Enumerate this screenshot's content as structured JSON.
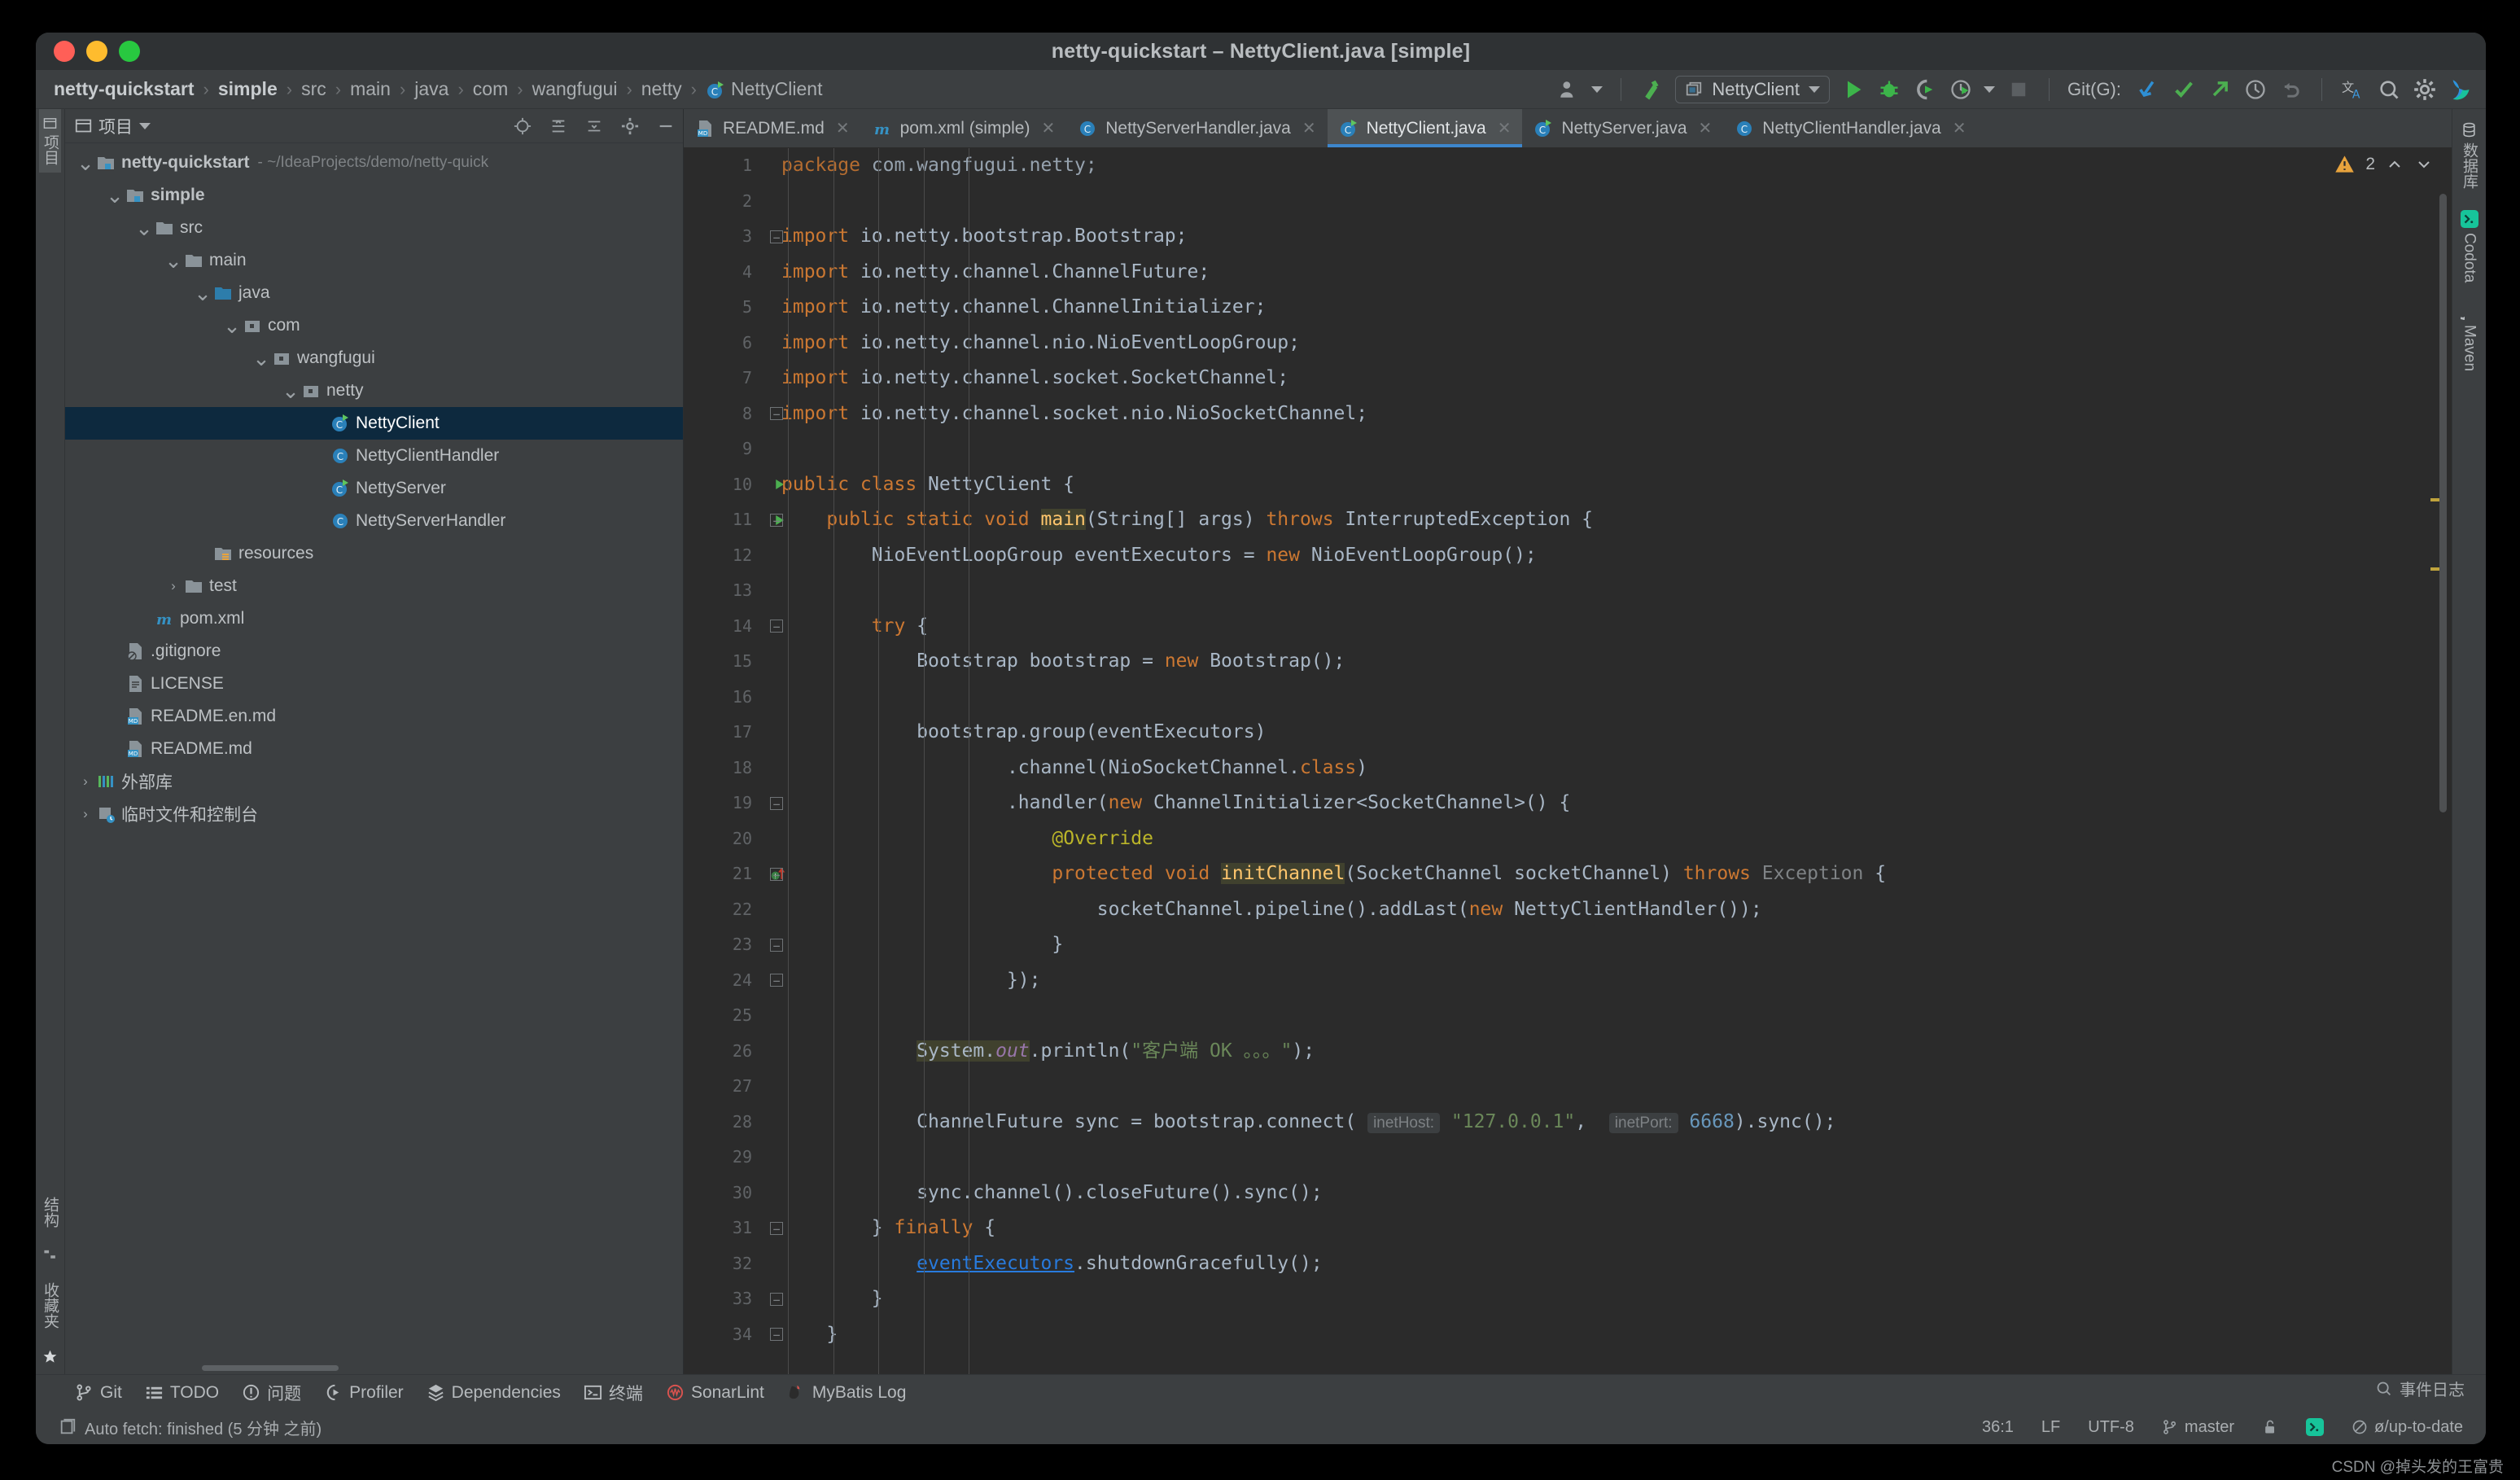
{
  "window": {
    "title": "netty-quickstart – NettyClient.java [simple]",
    "traffic": {
      "close": "close-button",
      "minimize": "minimize-button",
      "zoom": "zoom-button"
    }
  },
  "breadcrumbs": [
    {
      "label": "netty-quickstart",
      "bold": true
    },
    {
      "label": "simple",
      "bold": true
    },
    {
      "label": "src",
      "bold": false
    },
    {
      "label": "main",
      "bold": false
    },
    {
      "label": "java",
      "bold": false
    },
    {
      "label": "com",
      "bold": false
    },
    {
      "label": "wangfugui",
      "bold": false
    },
    {
      "label": "netty",
      "bold": false
    },
    {
      "label": "NettyClient",
      "bold": false,
      "icon": "java-class-runnable-icon"
    }
  ],
  "toolbar": {
    "run_config": "NettyClient",
    "git_label": "Git(G):",
    "buttons": [
      "user-icon",
      "build-hammer-icon",
      "run-icon",
      "debug-icon",
      "run-with-coverage-icon",
      "profile-icon",
      "stop-icon",
      "git-update-icon",
      "git-commit-icon",
      "git-push-icon",
      "history-icon",
      "rollback-icon",
      "translate-icon",
      "search-everywhere-icon",
      "settings-gear-icon",
      "codota-icon"
    ]
  },
  "left_strip": {
    "top": [
      {
        "label": "项目",
        "selected": true,
        "icon": "project-icon"
      }
    ],
    "bottom": [
      {
        "label": "结构",
        "icon": "structure-icon"
      },
      {
        "label": "收藏夹",
        "icon": "favorites-star-icon"
      }
    ]
  },
  "right_strip": [
    {
      "label": "数据库",
      "icon": "database-icon"
    },
    {
      "label": "Codota",
      "icon": "codota-icon"
    },
    {
      "label": "Maven",
      "icon": "maven-icon"
    }
  ],
  "project_panel": {
    "title": "项目",
    "tree": [
      {
        "depth": 0,
        "label": "netty-quickstart",
        "suffix": "- ~/IdeaProjects/demo/netty-quick",
        "arrow": "down",
        "icon": "module-icon",
        "bold": true,
        "selected": false
      },
      {
        "depth": 1,
        "label": "simple",
        "suffix": "",
        "arrow": "down",
        "icon": "module-icon",
        "bold": true,
        "selected": false
      },
      {
        "depth": 2,
        "label": "src",
        "suffix": "",
        "arrow": "down",
        "icon": "folder-icon",
        "bold": false,
        "selected": false
      },
      {
        "depth": 3,
        "label": "main",
        "suffix": "",
        "arrow": "down",
        "icon": "folder-icon",
        "bold": false,
        "selected": false
      },
      {
        "depth": 4,
        "label": "java",
        "suffix": "",
        "arrow": "down",
        "icon": "source-folder-icon",
        "bold": false,
        "selected": false
      },
      {
        "depth": 5,
        "label": "com",
        "suffix": "",
        "arrow": "down",
        "icon": "package-icon",
        "bold": false,
        "selected": false
      },
      {
        "depth": 6,
        "label": "wangfugui",
        "suffix": "",
        "arrow": "down",
        "icon": "package-icon",
        "bold": false,
        "selected": false
      },
      {
        "depth": 7,
        "label": "netty",
        "suffix": "",
        "arrow": "down",
        "icon": "package-icon",
        "bold": false,
        "selected": false
      },
      {
        "depth": 8,
        "label": "NettyClient",
        "suffix": "",
        "arrow": "none",
        "icon": "java-class-runnable-icon",
        "bold": false,
        "selected": true
      },
      {
        "depth": 8,
        "label": "NettyClientHandler",
        "suffix": "",
        "arrow": "none",
        "icon": "java-class-icon",
        "bold": false,
        "selected": false
      },
      {
        "depth": 8,
        "label": "NettyServer",
        "suffix": "",
        "arrow": "none",
        "icon": "java-class-runnable-icon",
        "bold": false,
        "selected": false
      },
      {
        "depth": 8,
        "label": "NettyServerHandler",
        "suffix": "",
        "arrow": "none",
        "icon": "java-class-icon",
        "bold": false,
        "selected": false
      },
      {
        "depth": 4,
        "label": "resources",
        "suffix": "",
        "arrow": "none",
        "icon": "resources-folder-icon",
        "bold": false,
        "selected": false
      },
      {
        "depth": 3,
        "label": "test",
        "suffix": "",
        "arrow": "right",
        "icon": "folder-icon",
        "bold": false,
        "selected": false
      },
      {
        "depth": 2,
        "label": "pom.xml",
        "suffix": "",
        "arrow": "none",
        "icon": "maven-icon",
        "bold": false,
        "selected": false
      },
      {
        "depth": 1,
        "label": ".gitignore",
        "suffix": "",
        "arrow": "none",
        "icon": "gitignore-icon",
        "bold": false,
        "selected": false
      },
      {
        "depth": 1,
        "label": "LICENSE",
        "suffix": "",
        "arrow": "none",
        "icon": "text-file-icon",
        "bold": false,
        "selected": false
      },
      {
        "depth": 1,
        "label": "README.en.md",
        "suffix": "",
        "arrow": "none",
        "icon": "markdown-icon",
        "bold": false,
        "selected": false
      },
      {
        "depth": 1,
        "label": "README.md",
        "suffix": "",
        "arrow": "none",
        "icon": "markdown-icon",
        "bold": false,
        "selected": false
      },
      {
        "depth": 0,
        "label": "外部库",
        "suffix": "",
        "arrow": "right",
        "icon": "external-libraries-icon",
        "bold": false,
        "selected": false
      },
      {
        "depth": 0,
        "label": "临时文件和控制台",
        "suffix": "",
        "arrow": "right",
        "icon": "scratches-icon",
        "bold": false,
        "selected": false
      }
    ]
  },
  "editor_tabs": [
    {
      "label": "README.md",
      "icon": "markdown-icon",
      "active": false
    },
    {
      "label": "pom.xml (simple)",
      "icon": "maven-icon",
      "active": false
    },
    {
      "label": "NettyServerHandler.java",
      "icon": "java-class-icon",
      "active": false
    },
    {
      "label": "NettyClient.java",
      "icon": "java-class-runnable-icon",
      "active": true
    },
    {
      "label": "NettyServer.java",
      "icon": "java-class-runnable-icon",
      "active": false
    },
    {
      "label": "NettyClientHandler.java",
      "icon": "java-class-icon",
      "active": false
    }
  ],
  "inspection": {
    "count": "2",
    "icon": "warning-triangle-icon"
  },
  "editor": {
    "first_visible_line": 1,
    "lines": [
      {
        "n": 1,
        "fold": "",
        "run": false,
        "partial": true,
        "tokens": [
          {
            "t": "package ",
            "c": "k"
          },
          {
            "t": "com.wangfugui.netty",
            "c": ""
          },
          {
            "t": ";",
            "c": ""
          }
        ]
      },
      {
        "n": 2,
        "fold": "",
        "run": false,
        "tokens": []
      },
      {
        "n": 3,
        "fold": "start",
        "run": false,
        "tokens": [
          {
            "t": "import ",
            "c": "k"
          },
          {
            "t": "io.netty.bootstrap.Bootstrap;",
            "c": ""
          }
        ]
      },
      {
        "n": 4,
        "fold": "",
        "run": false,
        "tokens": [
          {
            "t": "import ",
            "c": "k"
          },
          {
            "t": "io.netty.channel.ChannelFuture;",
            "c": ""
          }
        ]
      },
      {
        "n": 5,
        "fold": "",
        "run": false,
        "tokens": [
          {
            "t": "import ",
            "c": "k"
          },
          {
            "t": "io.netty.channel.ChannelInitializer;",
            "c": ""
          }
        ]
      },
      {
        "n": 6,
        "fold": "",
        "run": false,
        "tokens": [
          {
            "t": "import ",
            "c": "k"
          },
          {
            "t": "io.netty.channel.nio.NioEventLoopGroup;",
            "c": ""
          }
        ]
      },
      {
        "n": 7,
        "fold": "",
        "run": false,
        "tokens": [
          {
            "t": "import ",
            "c": "k"
          },
          {
            "t": "io.netty.channel.socket.SocketChannel;",
            "c": ""
          }
        ]
      },
      {
        "n": 8,
        "fold": "end",
        "run": false,
        "tokens": [
          {
            "t": "import ",
            "c": "k"
          },
          {
            "t": "io.netty.channel.socket.nio.NioSocketChannel;",
            "c": ""
          }
        ]
      },
      {
        "n": 9,
        "fold": "",
        "run": false,
        "tokens": []
      },
      {
        "n": 10,
        "fold": "",
        "run": true,
        "tokens": [
          {
            "t": "public class ",
            "c": "k"
          },
          {
            "t": "NettyClient {",
            "c": ""
          }
        ]
      },
      {
        "n": 11,
        "fold": "start",
        "run": true,
        "tokens": [
          {
            "t": "    public static void ",
            "c": "k"
          },
          {
            "t": "main",
            "c": "fnb"
          },
          {
            "t": "(String[] args) ",
            "c": ""
          },
          {
            "t": "throws ",
            "c": "k"
          },
          {
            "t": "InterruptedException {",
            "c": ""
          }
        ]
      },
      {
        "n": 12,
        "fold": "",
        "run": false,
        "tokens": [
          {
            "t": "        NioEventLoopGroup eventExecutors = ",
            "c": ""
          },
          {
            "t": "new ",
            "c": "k"
          },
          {
            "t": "NioEventLoopGroup();",
            "c": ""
          }
        ]
      },
      {
        "n": 13,
        "fold": "",
        "run": false,
        "tokens": []
      },
      {
        "n": 14,
        "fold": "start",
        "run": false,
        "tokens": [
          {
            "t": "        ",
            "c": ""
          },
          {
            "t": "try ",
            "c": "k"
          },
          {
            "t": "{",
            "c": ""
          }
        ]
      },
      {
        "n": 15,
        "fold": "",
        "run": false,
        "tokens": [
          {
            "t": "            Bootstrap bootstrap = ",
            "c": ""
          },
          {
            "t": "new ",
            "c": "k"
          },
          {
            "t": "Bootstrap();",
            "c": ""
          }
        ]
      },
      {
        "n": 16,
        "fold": "",
        "run": false,
        "tokens": []
      },
      {
        "n": 17,
        "fold": "",
        "run": false,
        "tokens": [
          {
            "t": "            bootstrap.group(eventExecutors)",
            "c": ""
          }
        ]
      },
      {
        "n": 18,
        "fold": "",
        "run": false,
        "tokens": [
          {
            "t": "                    .channel(NioSocketChannel.",
            "c": ""
          },
          {
            "t": "class",
            "c": "k"
          },
          {
            "t": ")",
            "c": ""
          }
        ]
      },
      {
        "n": 19,
        "fold": "start",
        "run": false,
        "tokens": [
          {
            "t": "                    .handler(",
            "c": ""
          },
          {
            "t": "new ",
            "c": "k"
          },
          {
            "t": "ChannelInitializer<SocketChannel>() {",
            "c": ""
          }
        ]
      },
      {
        "n": 20,
        "fold": "",
        "run": false,
        "tokens": [
          {
            "t": "                        ",
            "c": ""
          },
          {
            "t": "@Override",
            "c": "an"
          }
        ]
      },
      {
        "n": 21,
        "fold": "start",
        "run": false,
        "bulb": true,
        "tokens": [
          {
            "t": "                        ",
            "c": ""
          },
          {
            "t": "protected void ",
            "c": "k"
          },
          {
            "t": "initChannel",
            "c": "fnb"
          },
          {
            "t": "(SocketChannel socketChannel) ",
            "c": ""
          },
          {
            "t": "throws ",
            "c": "k"
          },
          {
            "t": "Exception ",
            "c": "err"
          },
          {
            "t": "{",
            "c": ""
          }
        ]
      },
      {
        "n": 22,
        "fold": "",
        "run": false,
        "tokens": [
          {
            "t": "                            socketChannel.pipeline().addLast(",
            "c": ""
          },
          {
            "t": "new ",
            "c": "k"
          },
          {
            "t": "NettyClientHandler());",
            "c": ""
          }
        ]
      },
      {
        "n": 23,
        "fold": "end",
        "run": false,
        "tokens": [
          {
            "t": "                        }",
            "c": ""
          }
        ]
      },
      {
        "n": 24,
        "fold": "end",
        "run": false,
        "tokens": [
          {
            "t": "                    });",
            "c": ""
          }
        ]
      },
      {
        "n": 25,
        "fold": "",
        "run": false,
        "tokens": []
      },
      {
        "n": 26,
        "fold": "",
        "run": false,
        "tokens": [
          {
            "t": "            ",
            "c": ""
          },
          {
            "t": "System.",
            "c": "hl"
          },
          {
            "t": "out",
            "c": "hlfld"
          },
          {
            "t": ".println(",
            "c": ""
          },
          {
            "t": "\"客户端 OK 。。。\"",
            "c": "s"
          },
          {
            "t": ");",
            "c": ""
          }
        ]
      },
      {
        "n": 27,
        "fold": "",
        "run": false,
        "tokens": []
      },
      {
        "n": 28,
        "fold": "",
        "run": false,
        "tokens": [
          {
            "t": "            ChannelFuture sync = bootstrap.connect( ",
            "c": ""
          },
          {
            "t": "inetHost:",
            "c": "hint"
          },
          {
            "t": " ",
            "c": ""
          },
          {
            "t": "\"127.0.0.1\"",
            "c": "s"
          },
          {
            "t": ",  ",
            "c": ""
          },
          {
            "t": "inetPort:",
            "c": "hint"
          },
          {
            "t": " ",
            "c": ""
          },
          {
            "t": "6668",
            "c": "n"
          },
          {
            "t": ").sync();",
            "c": ""
          }
        ]
      },
      {
        "n": 29,
        "fold": "",
        "run": false,
        "tokens": []
      },
      {
        "n": 30,
        "fold": "",
        "run": false,
        "tokens": [
          {
            "t": "            sync.channel().closeFuture().sync();",
            "c": ""
          }
        ]
      },
      {
        "n": 31,
        "fold": "start",
        "run": false,
        "tokens": [
          {
            "t": "        } ",
            "c": ""
          },
          {
            "t": "finally ",
            "c": "k"
          },
          {
            "t": "{",
            "c": ""
          }
        ]
      },
      {
        "n": 32,
        "fold": "",
        "run": false,
        "tokens": [
          {
            "t": "            ",
            "c": ""
          },
          {
            "t": "eventExecutors",
            "c": "ul"
          },
          {
            "t": ".shutdownGracefully();",
            "c": ""
          }
        ]
      },
      {
        "n": 33,
        "fold": "end",
        "run": false,
        "tokens": [
          {
            "t": "        }",
            "c": ""
          }
        ]
      },
      {
        "n": 34,
        "fold": "end",
        "run": false,
        "tokens": [
          {
            "t": "    }",
            "c": ""
          }
        ]
      }
    ]
  },
  "bottom_tools": [
    {
      "label": "Git",
      "icon": "git-branch-icon"
    },
    {
      "label": "TODO",
      "icon": "todo-list-icon"
    },
    {
      "label": "问题",
      "icon": "problems-icon"
    },
    {
      "label": "Profiler",
      "icon": "profiler-icon"
    },
    {
      "label": "Dependencies",
      "icon": "dependencies-icon"
    },
    {
      "label": "终端",
      "icon": "terminal-icon"
    },
    {
      "label": "SonarLint",
      "icon": "sonarlint-icon"
    },
    {
      "label": "MyBatis Log",
      "icon": "mybatis-icon"
    }
  ],
  "status_bar": {
    "message": "Auto fetch: finished (5 分钟 之前)",
    "caret": "36:1",
    "line_separator": "LF",
    "encoding": "UTF-8",
    "branch": "master",
    "event_log": "事件日志",
    "git_state": "ø/up-to-date",
    "lock_icon": "unlocked-icon",
    "codota_icon": "codota-icon"
  },
  "watermark": "CSDN @掉头发的王富贵"
}
